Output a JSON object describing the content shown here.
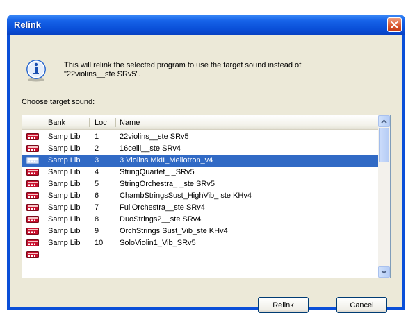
{
  "dialog": {
    "title": "Relink",
    "message_line1": "This will relink the selected program to use the target sound instead of",
    "message_line2": "\"22violins__ste SRv5\".",
    "choose_label": "Choose target sound:"
  },
  "columns": {
    "bank": "Bank",
    "loc": "Loc",
    "name": "Name"
  },
  "rows": [
    {
      "bank": "Samp Lib",
      "loc": "1",
      "name": "22violins__ste SRv5",
      "selected": false
    },
    {
      "bank": "Samp Lib",
      "loc": "2",
      "name": "16celli__ste SRv4",
      "selected": false
    },
    {
      "bank": "Samp Lib",
      "loc": "3",
      "name": "3 Violins MkII_Mellotron_v4",
      "selected": true
    },
    {
      "bank": "Samp Lib",
      "loc": "4",
      "name": "StringQuartet_ _SRv5",
      "selected": false
    },
    {
      "bank": "Samp Lib",
      "loc": "5",
      "name": "StringOrchestra_ _ste SRv5",
      "selected": false
    },
    {
      "bank": "Samp Lib",
      "loc": "6",
      "name": "ChambStringsSust_HighVib_ ste KHv4",
      "selected": false
    },
    {
      "bank": "Samp Lib",
      "loc": "7",
      "name": "FullOrchestra__ste SRv4",
      "selected": false
    },
    {
      "bank": "Samp Lib",
      "loc": "8",
      "name": "DuoStrings2__ste SRv4",
      "selected": false
    },
    {
      "bank": "Samp Lib",
      "loc": "9",
      "name": "OrchStrings Sust_Vib_ste KHv4",
      "selected": false
    },
    {
      "bank": "Samp Lib",
      "loc": "10",
      "name": "SoloViolin1_Vib_SRv5",
      "selected": false
    }
  ],
  "buttons": {
    "relink": "Relink",
    "cancel": "Cancel"
  },
  "icons": {
    "info": "info-icon",
    "close": "close-icon",
    "row": "sound-bank-icon"
  },
  "colors": {
    "titlebar": "#0a4fd8",
    "selection": "#316ac5",
    "close": "#d9542b"
  }
}
